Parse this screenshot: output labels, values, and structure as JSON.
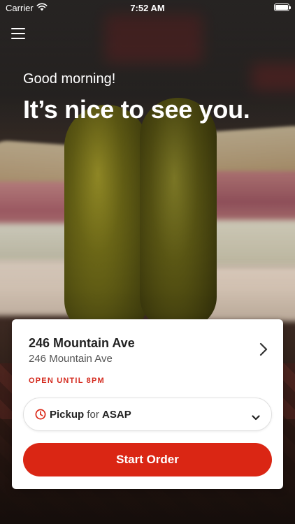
{
  "status_bar": {
    "carrier": "Carrier",
    "time": "7:52 AM"
  },
  "greeting": {
    "subtitle": "Good morning!",
    "headline": "It’s nice to see you."
  },
  "location": {
    "name": "246 Mountain Ave",
    "address": "246 Mountain Ave",
    "hours": "OPEN UNTIL 8PM"
  },
  "order_mode": {
    "mode": "Pickup",
    "connector": "for",
    "timing": "ASAP"
  },
  "cta": {
    "label": "Start Order"
  },
  "colors": {
    "accent": "#da2614",
    "hours_text": "#d42a1e"
  },
  "icons": [
    "menu-icon",
    "wifi-icon",
    "battery-icon",
    "chevron-right-icon",
    "clock-icon",
    "chevron-down-icon"
  ]
}
